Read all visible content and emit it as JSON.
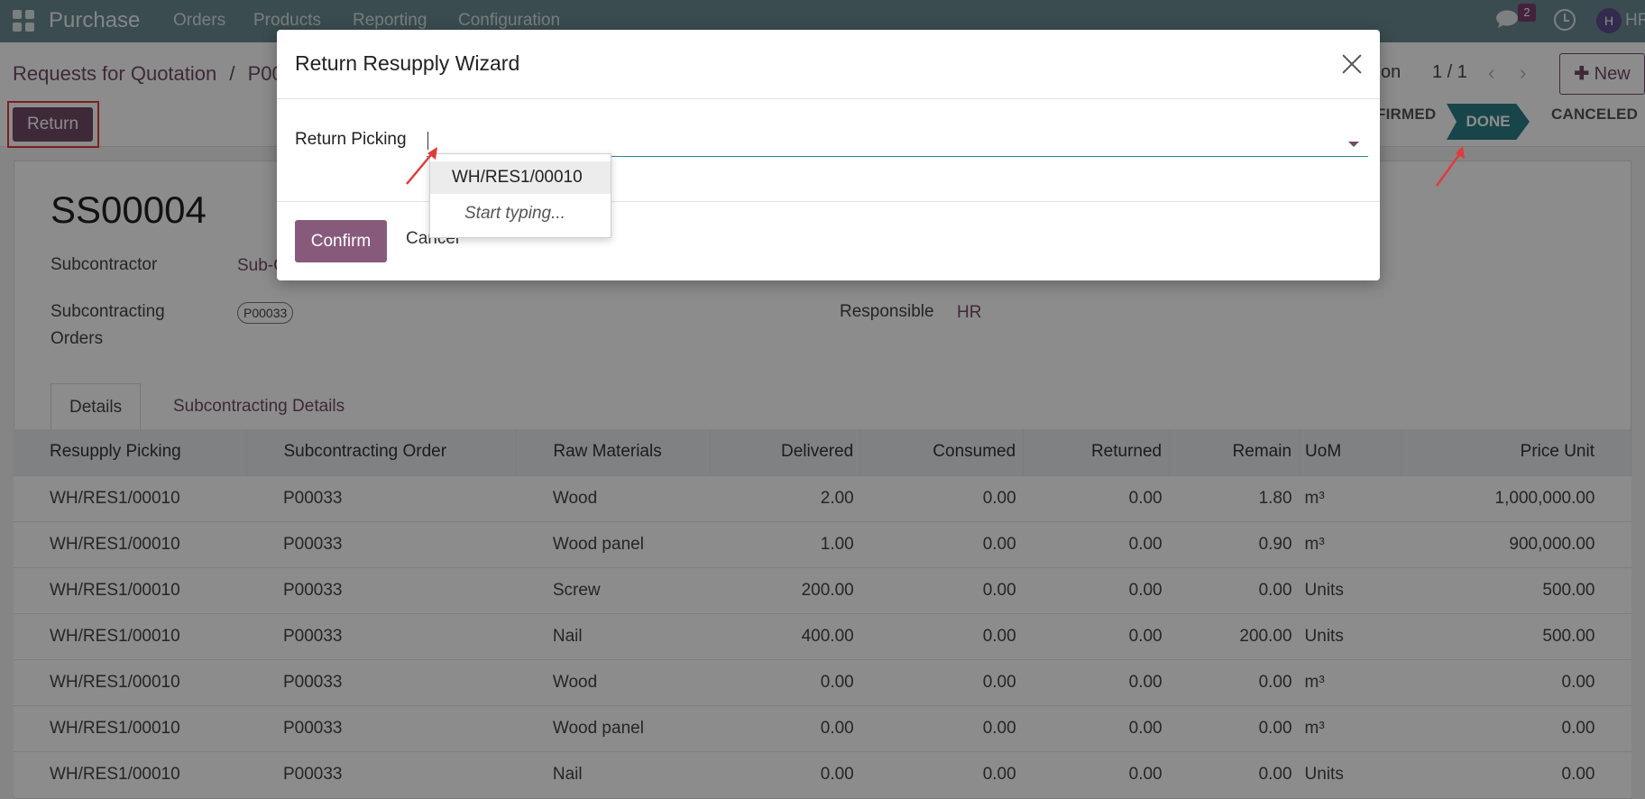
{
  "navbar": {
    "app_name": "Purchase",
    "menu": [
      "Orders",
      "Products",
      "Reporting",
      "Configuration"
    ],
    "chat_badge": "2",
    "avatar_initial": "H",
    "user_name": "HR"
  },
  "breadcrumb": {
    "parent": "Requests for Quotation",
    "separator": "/",
    "current": "P00"
  },
  "pager": {
    "partial_text": "on",
    "value": "1 / 1",
    "prev": "‹",
    "next": "›"
  },
  "actions": {
    "new_label": "New",
    "return_label": "Return"
  },
  "statusbar": {
    "confirmed_partial": "FIRMED",
    "done": "DONE",
    "canceled": "CANCELED"
  },
  "record": {
    "name": "SS00004",
    "subcontractor_label": "Subcontractor",
    "subcontractor_value": "Sub-C",
    "orders_label_line1": "Subcontracting",
    "orders_label_line2": "Orders",
    "orders_tag": "P00033",
    "responsible_label": "Responsible",
    "responsible_value": "HR"
  },
  "tabs": [
    "Details",
    "Subcontracting Details"
  ],
  "table": {
    "columns": [
      "Resupply Picking",
      "Subcontracting Order",
      "Raw Materials",
      "Delivered",
      "Consumed",
      "Returned",
      "Remain",
      "UoM",
      "Price Unit"
    ],
    "rows": [
      [
        "WH/RES1/00010",
        "P00033",
        "Wood",
        "2.00",
        "0.00",
        "0.00",
        "1.80",
        "m³",
        "1,000,000.00"
      ],
      [
        "WH/RES1/00010",
        "P00033",
        "Wood panel",
        "1.00",
        "0.00",
        "0.00",
        "0.90",
        "m³",
        "900,000.00"
      ],
      [
        "WH/RES1/00010",
        "P00033",
        "Screw",
        "200.00",
        "0.00",
        "0.00",
        "0.00",
        "Units",
        "500.00"
      ],
      [
        "WH/RES1/00010",
        "P00033",
        "Nail",
        "400.00",
        "0.00",
        "0.00",
        "200.00",
        "Units",
        "500.00"
      ],
      [
        "WH/RES1/00010",
        "P00033",
        "Wood",
        "0.00",
        "0.00",
        "0.00",
        "0.00",
        "m³",
        "0.00"
      ],
      [
        "WH/RES1/00010",
        "P00033",
        "Wood panel",
        "0.00",
        "0.00",
        "0.00",
        "0.00",
        "m³",
        "0.00"
      ],
      [
        "WH/RES1/00010",
        "P00033",
        "Nail",
        "0.00",
        "0.00",
        "0.00",
        "0.00",
        "Units",
        "0.00"
      ]
    ]
  },
  "modal": {
    "title": "Return Resupply Wizard",
    "field_label": "Return Picking",
    "field_value": "",
    "confirm_label": "Confirm",
    "cancel_label": "Cancel",
    "dropdown_option": "WH/RES1/00010",
    "dropdown_hint": "Start typing..."
  },
  "colors": {
    "navbar": "#6b8a93",
    "brand_purple": "#714b67",
    "done_teal": "#2a7e86",
    "annotation_red": "#e03b3b"
  }
}
